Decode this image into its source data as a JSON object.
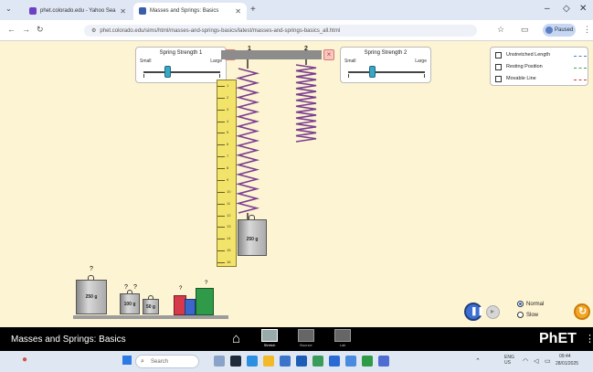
{
  "browser": {
    "tabs": [
      {
        "label": "phet.colorado.edu - Yahoo Sea",
        "active": false,
        "favicon_color": "#6d3fc4"
      },
      {
        "label": "Masses and Springs: Basics",
        "active": true,
        "favicon_color": "#3a5fa8"
      }
    ],
    "new_tab": "+",
    "url": "phet.colorado.edu/sims/html/masses-and-springs-basics/latest/masses-and-springs-basics_all.html",
    "profile_label": "Paused",
    "window_controls": [
      "–",
      "◇",
      "✕"
    ]
  },
  "sim": {
    "spring1_panel": {
      "title": "Spring Strength 1",
      "low": "Small",
      "high": "Large",
      "value_fraction": 0.4
    },
    "spring2_panel": {
      "title": "Spring Strength 2",
      "low": "Small",
      "high": "Large",
      "value_fraction": 0.4
    },
    "hook_labels": [
      "1",
      "2"
    ],
    "ruler_marks": [
      "1",
      "2",
      "3",
      "4",
      "5",
      "6",
      "7",
      "8",
      "9",
      "10",
      "11",
      "12",
      "13",
      "14",
      "15",
      "16"
    ],
    "attached_mass": {
      "label": "250 g"
    },
    "checkboxes": [
      {
        "label": "Unstretched Length",
        "checked": false,
        "line_color": "#4a7fd6"
      },
      {
        "label": "Resting Position",
        "checked": false,
        "line_color": "#3fa84a"
      },
      {
        "label": "Movable Line",
        "checked": false,
        "line_color": "#d23b3b"
      }
    ],
    "shelf_masses": [
      {
        "label": "250 g"
      },
      {
        "label": "100 g"
      },
      {
        "label": "50 g"
      }
    ],
    "unknown_label": "?",
    "speed_options": [
      {
        "label": "Normal",
        "selected": true
      },
      {
        "label": "Slow",
        "selected": false
      }
    ]
  },
  "navbar": {
    "title": "Masses and Springs: Basics",
    "screens": [
      "Stretch",
      "Bounce",
      "Lab"
    ],
    "logo": "PhET"
  },
  "taskbar": {
    "search_placeholder": "Search",
    "tray_lang": "ENG\nUS",
    "time": "09:44",
    "date": "28/01/2025"
  }
}
